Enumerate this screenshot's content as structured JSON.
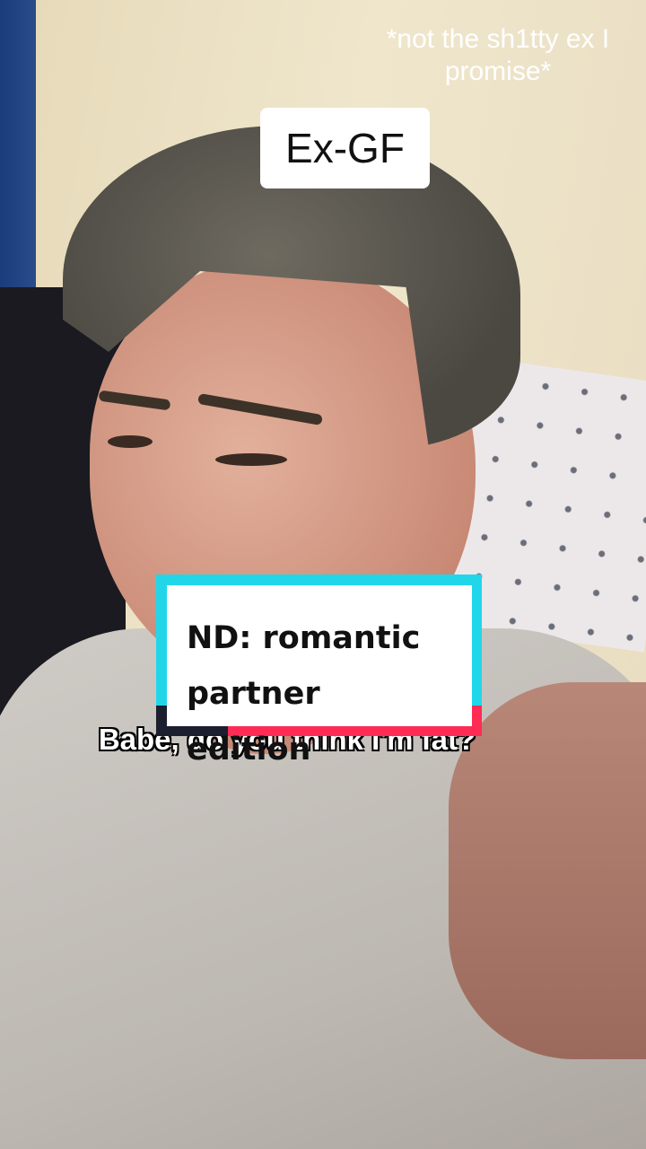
{
  "video": {
    "top_note": "*not the sh1tty ex I promise*",
    "character_label": "Ex-GF",
    "title_card": {
      "line1": "ND: romantic",
      "line2": "partner edition"
    },
    "subtitle": "Babe, do you think I'm fat?",
    "colors": {
      "cyan": "#22d6ea",
      "red": "#fe2c55",
      "dark": "#1c1f2e"
    }
  }
}
